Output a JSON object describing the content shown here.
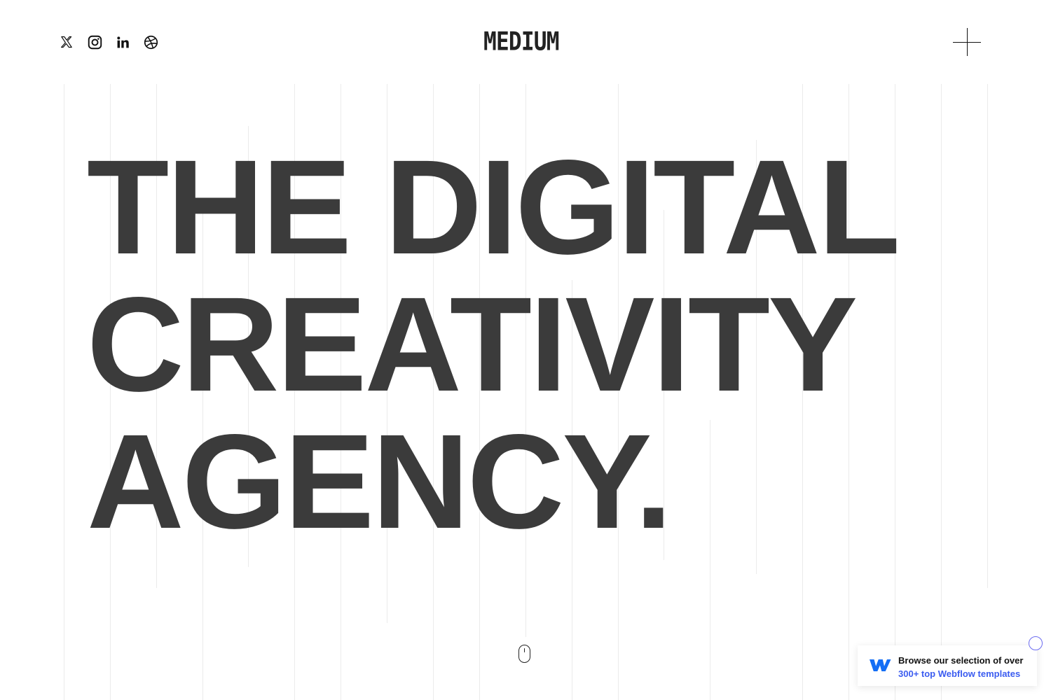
{
  "header": {
    "social_links": [
      {
        "name": "x-icon"
      },
      {
        "name": "instagram-icon"
      },
      {
        "name": "linkedin-icon"
      },
      {
        "name": "dribbble-icon"
      }
    ],
    "logo_text": "MEDIUM",
    "menu_icon": "plus-icon"
  },
  "hero": {
    "lines": [
      "THE DIGITAL",
      "CREATIVITY",
      "AGENCY."
    ]
  },
  "scroll_indicator": {
    "icon": "mouse-scroll-icon"
  },
  "webflow_badge": {
    "line1": "Browse our selection of over",
    "line2": "300+ top Webflow templates",
    "icon": "webflow-logo-icon"
  },
  "colors": {
    "hero_text": "#3b3b3b",
    "badge_link": "#3b5cf0",
    "webflow_blue": "#146ef5",
    "grid_line": "#ebebeb"
  }
}
